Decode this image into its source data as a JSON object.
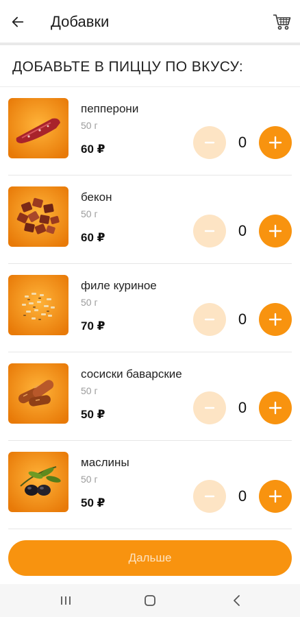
{
  "app_bar": {
    "title": "Добавки",
    "back_icon": "arrow-left-icon",
    "cart_icon": "cart-icon"
  },
  "subtitle": "ДОБАВЬТЕ В ПИЦЦУ ПО ВКУСУ:",
  "items": [
    {
      "name": "пепперони",
      "weight": "50 г",
      "price": "60 ₽",
      "quantity": "0"
    },
    {
      "name": "бекон",
      "weight": "50 г",
      "price": "60 ₽",
      "quantity": "0"
    },
    {
      "name": "филе куриное",
      "weight": "50 г",
      "price": "70 ₽",
      "quantity": "0"
    },
    {
      "name": "сосиски баварские",
      "weight": "50 г",
      "price": "50 ₽",
      "quantity": "0"
    },
    {
      "name": "маслины",
      "weight": "50 г",
      "price": "50 ₽",
      "quantity": "0"
    }
  ],
  "next_button": "Дальше",
  "colors": {
    "accent": "#f8930f",
    "accent_light": "#fde4c4",
    "thumb_bg": "#f39a1a"
  }
}
